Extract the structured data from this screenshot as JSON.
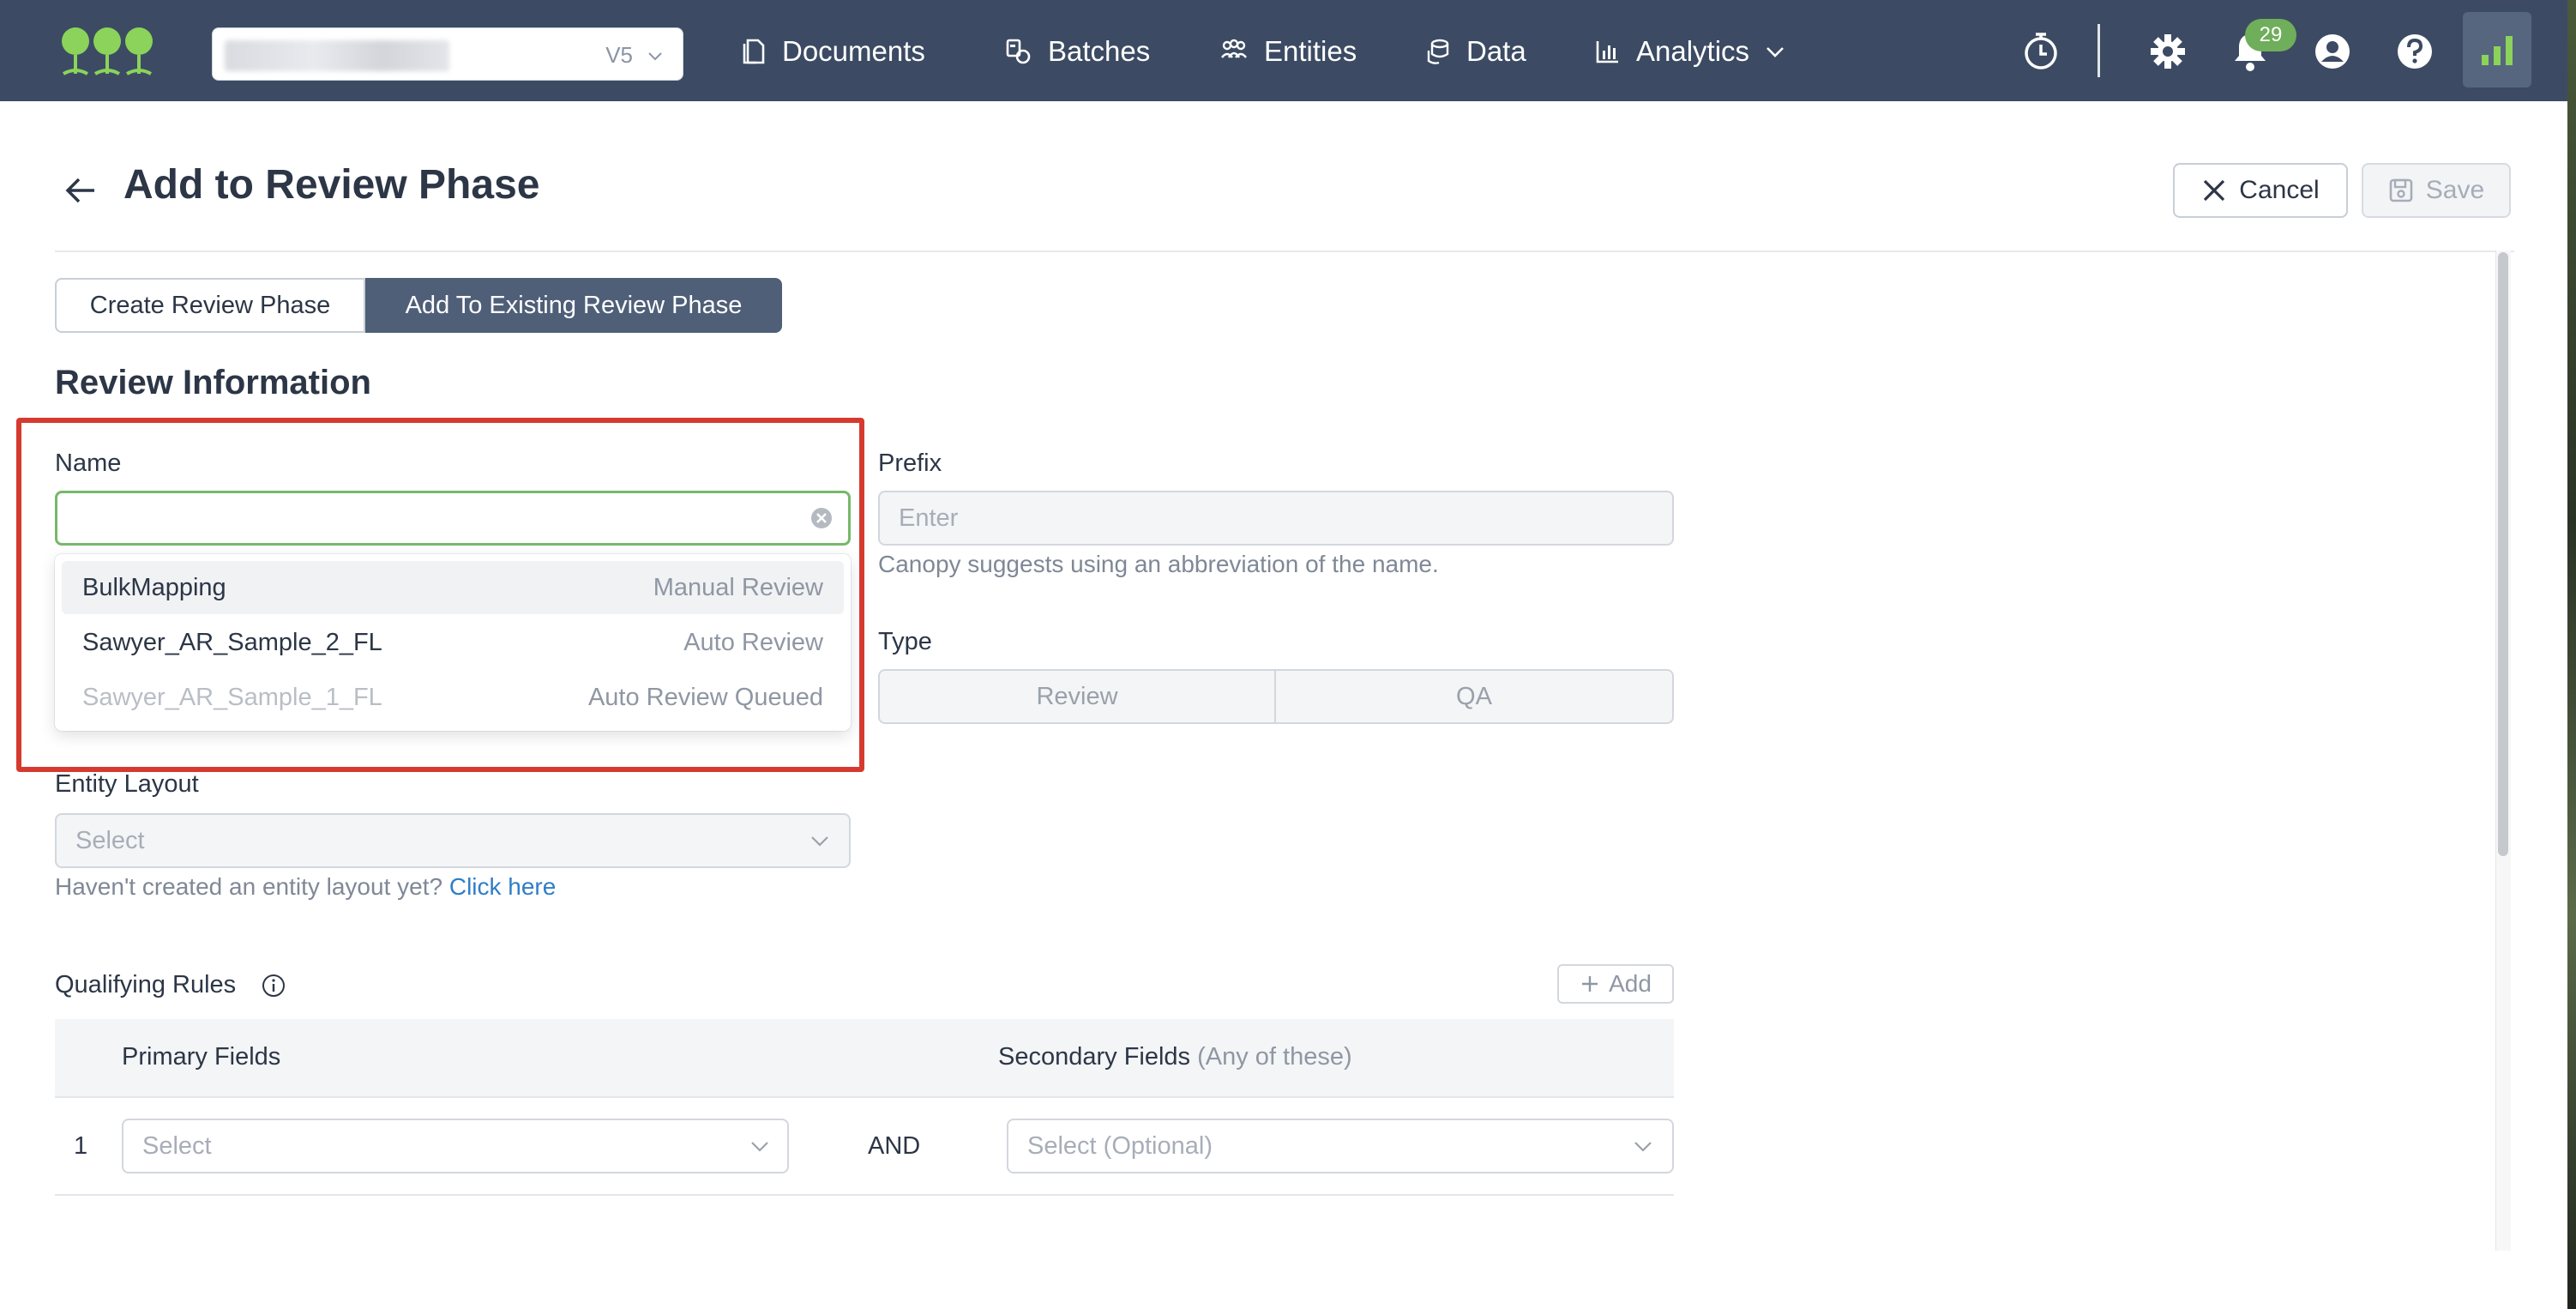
{
  "nav": {
    "workspace_version": "V5",
    "items": [
      {
        "label": "Documents",
        "icon": "documents-icon"
      },
      {
        "label": "Batches",
        "icon": "batches-icon"
      },
      {
        "label": "Entities",
        "icon": "entities-icon"
      },
      {
        "label": "Data",
        "icon": "data-icon"
      },
      {
        "label": "Analytics",
        "icon": "analytics-icon"
      }
    ],
    "notification_count": "29",
    "colors": {
      "bar": "#3c4b63",
      "badge": "#6fae5a",
      "brand_accent": "#8bd35a"
    }
  },
  "header": {
    "title": "Add to Review Phase",
    "cancel_label": "Cancel",
    "save_label": "Save"
  },
  "tabs": [
    {
      "label": "Create Review Phase",
      "active": false
    },
    {
      "label": "Add To Existing Review Phase",
      "active": true
    }
  ],
  "form": {
    "section_title": "Review Information",
    "name": {
      "label": "Name",
      "value": "",
      "options": [
        {
          "name": "BulkMapping",
          "status": "Manual Review",
          "enabled": true
        },
        {
          "name": "Sawyer_AR_Sample_2_FL",
          "status": "Auto Review",
          "enabled": true
        },
        {
          "name": "Sawyer_AR_Sample_1_FL",
          "status": "Auto Review Queued",
          "enabled": false
        }
      ]
    },
    "prefix": {
      "label": "Prefix",
      "placeholder": "Enter",
      "help": "Canopy suggests using an abbreviation of the name."
    },
    "type": {
      "label": "Type",
      "options": [
        "Review",
        "QA"
      ]
    },
    "entity_layout": {
      "label": "Entity Layout",
      "placeholder": "Select",
      "help": "Haven't created an entity layout yet?",
      "help_link": "Click here"
    },
    "qualifying_rules": {
      "label": "Qualifying Rules",
      "add_label": "Add",
      "primary_header": "Primary Fields",
      "secondary_header": "Secondary Fields",
      "secondary_header_note": "(Any of these)",
      "rows": [
        {
          "index": "1",
          "primary_placeholder": "Select",
          "joiner": "AND",
          "secondary_placeholder": "Select (Optional)"
        }
      ]
    }
  }
}
